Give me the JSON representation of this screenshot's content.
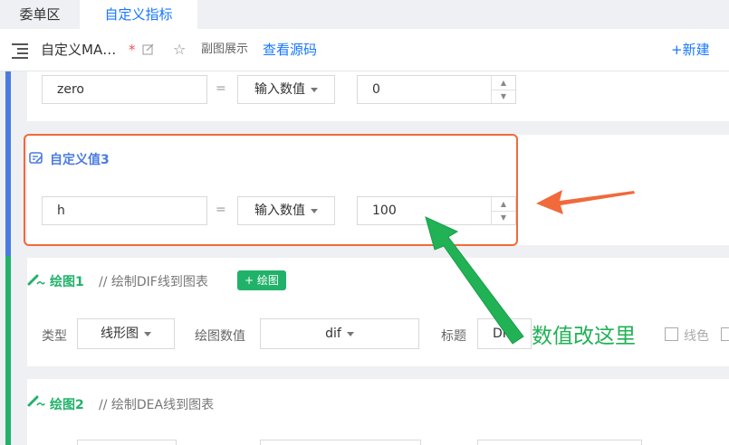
{
  "tabs": [
    {
      "label": "委单区",
      "active": false
    },
    {
      "label": "自定义指标",
      "active": true
    }
  ],
  "toolbar": {
    "outline_icon": "outline-list-icon",
    "title": "自定义MA…",
    "unsaved_mark": "*",
    "edit_icon": "edit-icon",
    "star_icon": "star-icon",
    "view_mode": "副图展示",
    "view_source": "查看源码",
    "new_button": "+新建"
  },
  "params": [
    {
      "name": "zero",
      "eq": "=",
      "type": "输入数值",
      "value": "0"
    },
    {
      "title": "自定义值3",
      "name": "h",
      "eq": "=",
      "type": "输入数值",
      "value": "100",
      "highlighted": true
    }
  ],
  "draws": [
    {
      "title": "绘图1",
      "comment": "// 绘制DIF线到图表",
      "add_button": "+ 绘图",
      "fields": {
        "type_label": "类型",
        "type_value": "线形图",
        "data_label": "绘图数值",
        "data_value": "dif",
        "title_label": "标题",
        "title_value": "DIF",
        "color_label": "线色"
      }
    },
    {
      "title": "绘图2",
      "comment": "// 绘制DEA线到图表"
    }
  ],
  "annotation": {
    "text": "数值改这里",
    "arrow_orange": "#f06a3b",
    "arrow_green": "#20b255",
    "box_color": "#f06a3b"
  },
  "colors": {
    "accent_blue": "#1677ff",
    "param_bar": "#4a7be0",
    "draw_green": "#21b26a"
  }
}
